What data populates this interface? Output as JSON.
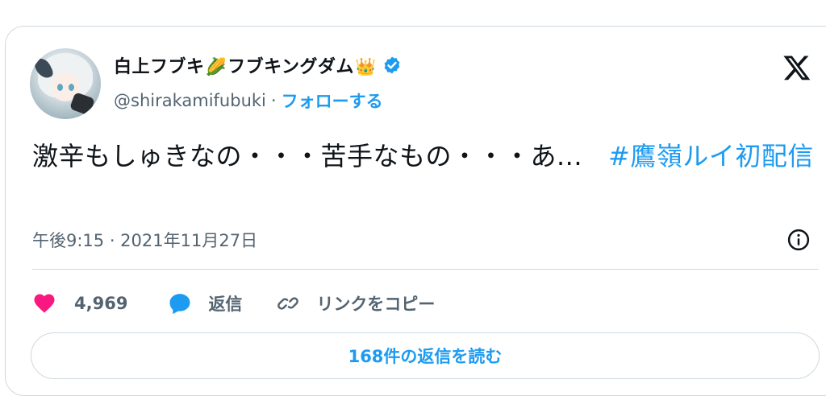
{
  "author": {
    "name_part1": "白上フブキ",
    "name_emoji1": "🌽",
    "name_part2": "フブキングダム",
    "name_emoji2": "👑",
    "handle": "@shirakamifubuki",
    "separator": "·",
    "follow_label": "フォローする"
  },
  "tweet": {
    "text": "激辛もしゅきなの・・・苦手なもの・・・あ...",
    "hashtag": "#鷹嶺ルイ初配信",
    "timestamp": "午後9:15 · 2021年11月27日"
  },
  "actions": {
    "like_count": "4,969",
    "reply_label": "返信",
    "copy_link_label": "リンクをコピー"
  },
  "read_replies_label": "168件の返信を読む",
  "colors": {
    "accent": "#1d9bf0",
    "like": "#f91880",
    "text": "#0f1419",
    "muted": "#536471",
    "border": "#cfd9de"
  },
  "icons": [
    "verified-badge-icon",
    "x-logo-icon",
    "info-icon",
    "heart-icon",
    "reply-bubble-icon",
    "link-icon"
  ]
}
